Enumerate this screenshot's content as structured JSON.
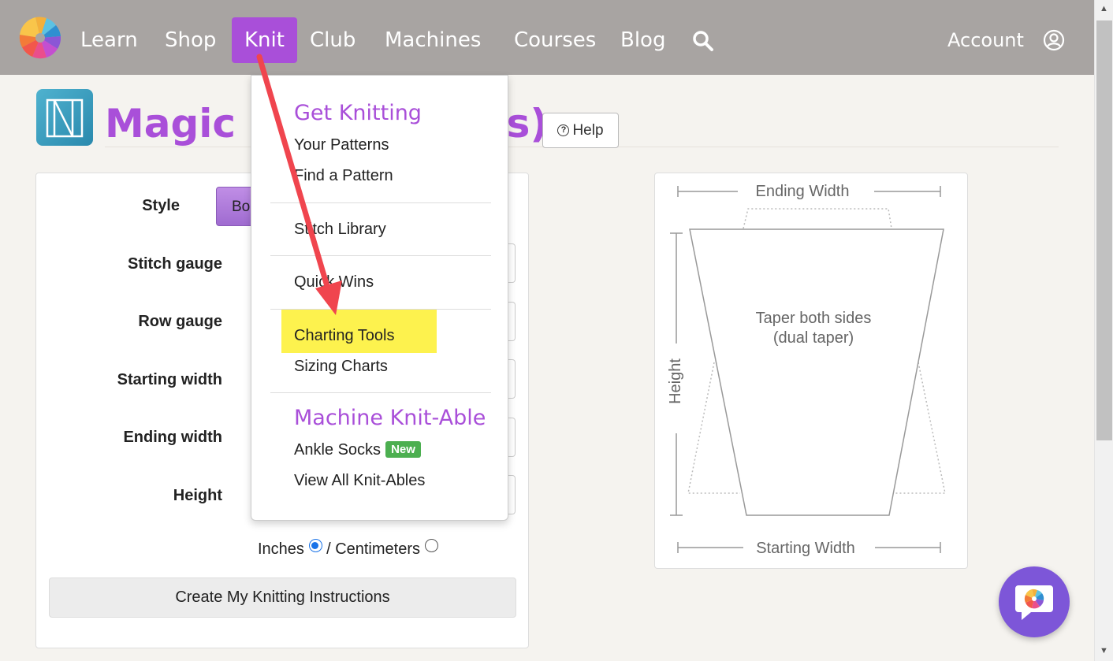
{
  "nav": {
    "items": [
      "Learn",
      "Shop",
      "Knit",
      "Club",
      "Machines",
      "Courses",
      "Blog"
    ],
    "active_item": "Knit",
    "account_label": "Account"
  },
  "page": {
    "title_visible": "Magic F",
    "title_suffix_visible": "s)",
    "help_label": "Help"
  },
  "form": {
    "labels": {
      "style": "Style",
      "stitch_gauge": "Stitch gauge",
      "row_gauge": "Row gauge",
      "starting_width": "Starting width",
      "ending_width": "Ending width",
      "height": "Height"
    },
    "style_button_visible": "Bo",
    "units": {
      "inches": "Inches",
      "separator": "/",
      "centimeters": "Centimeters",
      "selected": "Inches"
    },
    "create_button": "Create My Knitting Instructions"
  },
  "diagram": {
    "ending_width_label": "Ending Width",
    "starting_width_label": "Starting Width",
    "height_label": "Height",
    "caption_line1": "Taper both sides",
    "caption_line2": "(dual taper)"
  },
  "dropdown": {
    "section1": {
      "heading": "Get Knitting",
      "items": [
        "Your Patterns",
        "Find a Pattern"
      ]
    },
    "stitch_library": "Stitch Library",
    "quick_wins": "Quick Wins",
    "charting_tools": "Charting Tools",
    "sizing_charts": "Sizing Charts",
    "section2": {
      "heading": "Machine Knit-Able",
      "ankle_socks": "Ankle Socks",
      "badge": "New",
      "view_all": "View All Knit-Ables"
    }
  },
  "colors": {
    "brand_purple": "#a94fd9",
    "nav_bg": "#a8a4a2",
    "highlight": "#fdf24e",
    "arrow": "#f0454e",
    "badge_green": "#4caf50"
  }
}
